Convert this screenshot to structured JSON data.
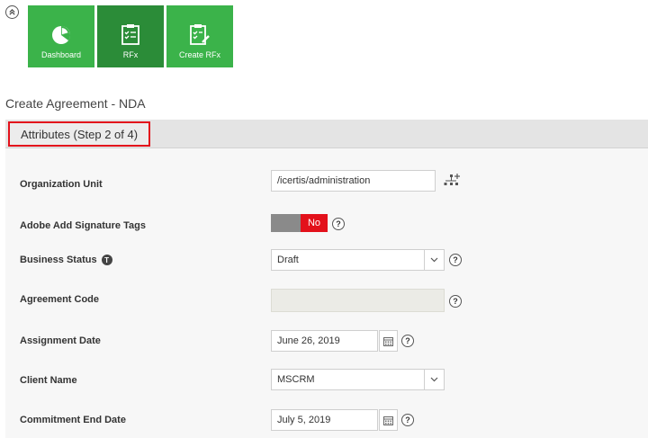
{
  "nav": {
    "tiles": [
      {
        "label": "Dashboard",
        "icon": "pie-chart-icon"
      },
      {
        "label": "RFx",
        "icon": "clipboard-checklist-icon"
      },
      {
        "label": "Create RFx",
        "icon": "clipboard-edit-icon"
      }
    ]
  },
  "page": {
    "title": "Create Agreement - NDA",
    "step_label": "Attributes (Step 2 of 4)"
  },
  "form": {
    "organization_unit": {
      "label": "Organization Unit",
      "value": "/icertis/administration"
    },
    "adobe_tags": {
      "label": "Adobe Add Signature Tags",
      "value": "No"
    },
    "business_status": {
      "label": "Business Status",
      "value": "Draft",
      "info_glyph": "T"
    },
    "agreement_code": {
      "label": "Agreement Code",
      "value": ""
    },
    "assignment_date": {
      "label": "Assignment Date",
      "value": "June 26, 2019"
    },
    "client_name": {
      "label": "Client Name",
      "value": "MSCRM"
    },
    "commitment_end_date": {
      "label": "Commitment End Date",
      "value": "July 5, 2019"
    },
    "help_glyph": "?"
  },
  "colors": {
    "tile_green": "#3bb34a",
    "tile_active": "#2b8c38",
    "highlight_red": "#e3111b",
    "toggle_gray": "#8a8a8a"
  }
}
